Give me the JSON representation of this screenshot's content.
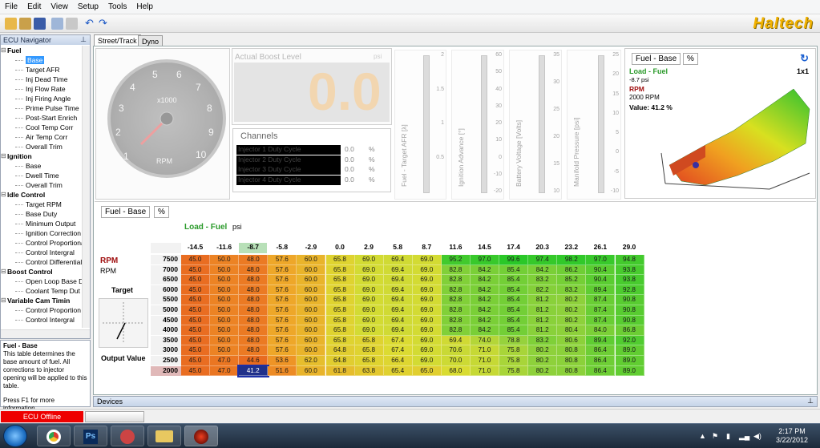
{
  "menu": [
    "File",
    "Edit",
    "View",
    "Setup",
    "Tools",
    "Help"
  ],
  "logo": "Haltech",
  "nav": {
    "title": "ECU Navigator",
    "items": [
      {
        "t": "grp",
        "label": "Fuel"
      },
      {
        "t": "it",
        "label": "Base",
        "sel": true
      },
      {
        "t": "it",
        "label": "Target AFR"
      },
      {
        "t": "it",
        "label": "Inj Dead Time"
      },
      {
        "t": "it",
        "label": "Inj Flow Rate"
      },
      {
        "t": "it",
        "label": "Inj Firing Angle"
      },
      {
        "t": "it",
        "label": "Prime Pulse Time"
      },
      {
        "t": "it",
        "label": "Post-Start Enrich"
      },
      {
        "t": "it",
        "label": "Cool Temp Corr"
      },
      {
        "t": "it",
        "label": "Air Temp Corr"
      },
      {
        "t": "it",
        "label": "Overall Trim"
      },
      {
        "t": "grp",
        "label": "Ignition"
      },
      {
        "t": "it",
        "label": "Base"
      },
      {
        "t": "it",
        "label": "Dwell Time"
      },
      {
        "t": "it",
        "label": "Overall Trim"
      },
      {
        "t": "grp",
        "label": "Idle Control"
      },
      {
        "t": "it",
        "label": "Target RPM"
      },
      {
        "t": "it",
        "label": "Base Duty"
      },
      {
        "t": "it",
        "label": "Minimum Output"
      },
      {
        "t": "it",
        "label": "Ignition Correction"
      },
      {
        "t": "it",
        "label": "Control Proportional"
      },
      {
        "t": "it",
        "label": "Control Intergral"
      },
      {
        "t": "it",
        "label": "Control Differential"
      },
      {
        "t": "grp",
        "label": "Boost Control"
      },
      {
        "t": "it",
        "label": "Open Loop Base D"
      },
      {
        "t": "it",
        "label": "Coolant Temp Dut"
      },
      {
        "t": "grp",
        "label": "Variable Cam Timin"
      },
      {
        "t": "it",
        "label": "Control Proportion"
      },
      {
        "t": "it",
        "label": "Control Intergral"
      }
    ]
  },
  "help": {
    "title": "Fuel - Base",
    "body": "This table determines the base amount of fuel. All corrections to injector opening will be applied to this table.",
    "hint": "Press F1 for more information"
  },
  "tabs": [
    "Street/Track",
    "Dyno"
  ],
  "gauge": {
    "label": "RPM",
    "unit": "x1000",
    "ticks": [
      "1",
      "2",
      "3",
      "4",
      "5",
      "6",
      "7",
      "8",
      "9",
      "10"
    ]
  },
  "boost": {
    "title": "Actual Boost Level",
    "unit": "psi",
    "value": "0.0"
  },
  "channels": {
    "title": "Channels",
    "rows": [
      {
        "name": "Injector 1 Duty Cycle",
        "value": "0.0",
        "unit": "%"
      },
      {
        "name": "Injector 2 Duty Cycle",
        "value": "0.0",
        "unit": "%"
      },
      {
        "name": "Injector 3 Duty Cycle",
        "value": "0.0",
        "unit": "%"
      },
      {
        "name": "Injector 4 Duty Cycle",
        "value": "0.0",
        "unit": "%"
      }
    ]
  },
  "bars": [
    {
      "label": "Fuel - Target AFR [λ]",
      "ticks": [
        "2",
        "1.5",
        "1",
        "0.5",
        ""
      ]
    },
    {
      "label": "Ignition Advance [°]",
      "ticks": [
        "60",
        "50",
        "40",
        "30",
        "20",
        "10",
        "0",
        "-10",
        "-20"
      ]
    },
    {
      "label": "Battery Voltage [Volts]",
      "ticks": [
        "35",
        "30",
        "25",
        "20",
        "15",
        "10"
      ]
    },
    {
      "label": "Manifold Pressure [psi]",
      "ticks": [
        "25",
        "20",
        "15",
        "10",
        "5",
        "0",
        "-5",
        "-10"
      ]
    }
  ],
  "surface": {
    "title": "Fuel - Base",
    "tab2": "%",
    "load_label": "Load - Fuel",
    "load_val": "-8.7 psi",
    "rpm_label": "RPM",
    "rpm_val": "2000 RPM",
    "value": "Value: 41.2 %",
    "zoom": "1x1"
  },
  "table": {
    "title": "Fuel - Base",
    "tab2": "%",
    "load_label": "Load - Fuel",
    "load_unit": "psi",
    "rpm_label": "RPM",
    "rpm_sub": "RPM",
    "target": "Target",
    "output": "Output Value",
    "cols": [
      "-14.5",
      "-11.6",
      "-8.7",
      "-5.8",
      "-2.9",
      "0.0",
      "2.9",
      "5.8",
      "8.7",
      "11.6",
      "14.5",
      "17.4",
      "20.3",
      "23.2",
      "26.1",
      "29.0"
    ],
    "rows": [
      {
        "rpm": "7500",
        "v": [
          "45.0",
          "50.0",
          "48.0",
          "57.6",
          "60.0",
          "65.8",
          "69.0",
          "69.4",
          "69.0",
          "95.2",
          "97.0",
          "99.6",
          "97.4",
          "98.2",
          "97.0",
          "94.8"
        ]
      },
      {
        "rpm": "7000",
        "v": [
          "45.0",
          "50.0",
          "48.0",
          "57.6",
          "60.0",
          "65.8",
          "69.0",
          "69.4",
          "69.0",
          "82.8",
          "84.2",
          "85.4",
          "84.2",
          "86.2",
          "90.4",
          "93.8"
        ]
      },
      {
        "rpm": "6500",
        "v": [
          "45.0",
          "50.0",
          "48.0",
          "57.6",
          "60.0",
          "65.8",
          "69.0",
          "69.4",
          "69.0",
          "82.8",
          "84.2",
          "85.4",
          "83.2",
          "85.2",
          "90.4",
          "93.8"
        ]
      },
      {
        "rpm": "6000",
        "v": [
          "45.0",
          "50.0",
          "48.0",
          "57.6",
          "60.0",
          "65.8",
          "69.0",
          "69.4",
          "69.0",
          "82.8",
          "84.2",
          "85.4",
          "82.2",
          "83.2",
          "89.4",
          "92.8"
        ]
      },
      {
        "rpm": "5500",
        "v": [
          "45.0",
          "50.0",
          "48.0",
          "57.6",
          "60.0",
          "65.8",
          "69.0",
          "69.4",
          "69.0",
          "82.8",
          "84.2",
          "85.4",
          "81.2",
          "80.2",
          "87.4",
          "90.8"
        ]
      },
      {
        "rpm": "5000",
        "v": [
          "45.0",
          "50.0",
          "48.0",
          "57.6",
          "60.0",
          "65.8",
          "69.0",
          "69.4",
          "69.0",
          "82.8",
          "84.2",
          "85.4",
          "81.2",
          "80.2",
          "87.4",
          "90.8"
        ]
      },
      {
        "rpm": "4500",
        "v": [
          "45.0",
          "50.0",
          "48.0",
          "57.6",
          "60.0",
          "65.8",
          "69.0",
          "69.4",
          "69.0",
          "82.8",
          "84.2",
          "85.4",
          "81.2",
          "80.2",
          "87.4",
          "90.8"
        ]
      },
      {
        "rpm": "4000",
        "v": [
          "45.0",
          "50.0",
          "48.0",
          "57.6",
          "60.0",
          "65.8",
          "69.0",
          "69.4",
          "69.0",
          "82.8",
          "84.2",
          "85.4",
          "81.2",
          "80.4",
          "84.0",
          "86.8"
        ]
      },
      {
        "rpm": "3500",
        "v": [
          "45.0",
          "50.0",
          "48.0",
          "57.6",
          "60.0",
          "65.8",
          "65.8",
          "67.4",
          "69.0",
          "69.4",
          "74.0",
          "78.8",
          "83.2",
          "80.6",
          "89.4",
          "92.0"
        ]
      },
      {
        "rpm": "3000",
        "v": [
          "45.0",
          "50.0",
          "48.0",
          "57.6",
          "60.0",
          "64.8",
          "65.8",
          "67.4",
          "69.0",
          "70.6",
          "71.0",
          "75.8",
          "80.2",
          "80.8",
          "86.4",
          "89.0"
        ]
      },
      {
        "rpm": "2500",
        "v": [
          "45.0",
          "47.0",
          "44.6",
          "53.6",
          "62.0",
          "64.8",
          "65.8",
          "66.4",
          "69.0",
          "70.0",
          "71.0",
          "75.8",
          "80.2",
          "80.8",
          "86.4",
          "89.0"
        ]
      },
      {
        "rpm": "2000",
        "v": [
          "45.0",
          "47.0",
          "41.2",
          "51.6",
          "60.0",
          "61.8",
          "63.8",
          "65.4",
          "65.0",
          "68.0",
          "71.0",
          "75.8",
          "80.2",
          "80.8",
          "86.4",
          "89.0"
        ]
      }
    ],
    "current": {
      "row": 11,
      "col": 2
    }
  },
  "devices": "Devices",
  "status": {
    "ecu": "ECU Offline"
  },
  "clock": {
    "time": "2:17 PM",
    "date": "3/22/2012"
  }
}
